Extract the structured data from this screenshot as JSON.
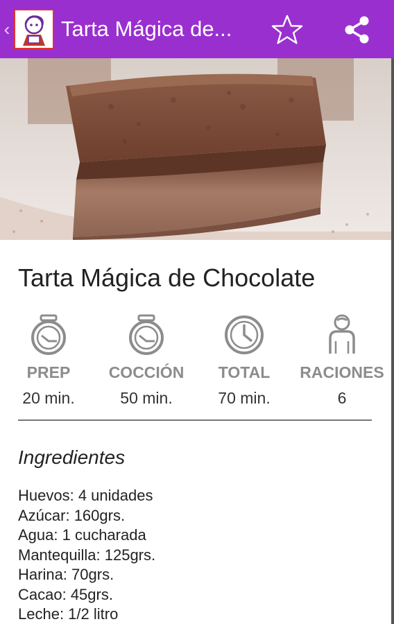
{
  "app_bar": {
    "back_glyph": "‹",
    "title": "Tarta Mágica de...",
    "bg_color": "#9a2fcf",
    "icons": [
      "app-logo-icon",
      "star-icon",
      "share-icon"
    ]
  },
  "recipe": {
    "title": "Tarta Mágica de Chocolate",
    "stats": [
      {
        "icon": "stopwatch-icon",
        "label": "PREP",
        "value": "20 min."
      },
      {
        "icon": "stopwatch-icon",
        "label": "COCCIÓN",
        "value": "50 min."
      },
      {
        "icon": "clock-icon",
        "label": "TOTAL",
        "value": "70 min."
      },
      {
        "icon": "person-icon",
        "label": "RACIONES",
        "value": "6"
      }
    ]
  },
  "ingredients": {
    "heading": "Ingredientes",
    "items": [
      "Huevos: 4 unidades",
      "Azúcar: 160grs.",
      "Agua: 1 cucharada",
      "Mantequilla: 125grs.",
      "Harina: 70grs.",
      "Cacao: 45grs.",
      "Leche: 1/2 litro"
    ]
  }
}
